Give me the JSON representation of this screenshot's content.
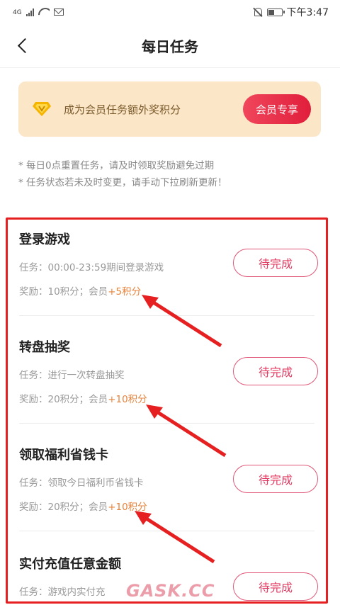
{
  "status_bar": {
    "network_label": "4G",
    "time": "下午3:47",
    "battery_level_percent": 45
  },
  "nav": {
    "title": "每日任务"
  },
  "vip_banner": {
    "text": "成为会员任务额外奖积分",
    "button_label": "会员专享"
  },
  "notes": [
    "* 每日0点重置任务，请及时领取奖励避免过期",
    "* 任务状态若未及时变更，请手动下拉刷新更新！"
  ],
  "tasks": [
    {
      "title": "登录游戏",
      "desc": "任务：00:00-23:59期间登录游戏",
      "reward": "奖励：10积分；会员",
      "bonus": "+5积分",
      "button": "待完成"
    },
    {
      "title": "转盘抽奖",
      "desc": "任务：进行一次转盘抽奖",
      "reward": "奖励：20积分；会员",
      "bonus": "+10积分",
      "button": "待完成"
    },
    {
      "title": "领取福利省钱卡",
      "desc": "任务：领取今日福利币省钱卡",
      "reward": "奖励：20积分；会员",
      "bonus": "+10积分",
      "button": "待完成"
    },
    {
      "title": "实付充值任意金额",
      "desc": "任务：游戏内实付充",
      "button": "待完成"
    }
  ],
  "watermark": "GASK.CC",
  "colors": {
    "accent": "#e01e3c",
    "frame": "#e62020",
    "bonus": "#e8833a",
    "banner_bg": "#fbe6c8"
  }
}
